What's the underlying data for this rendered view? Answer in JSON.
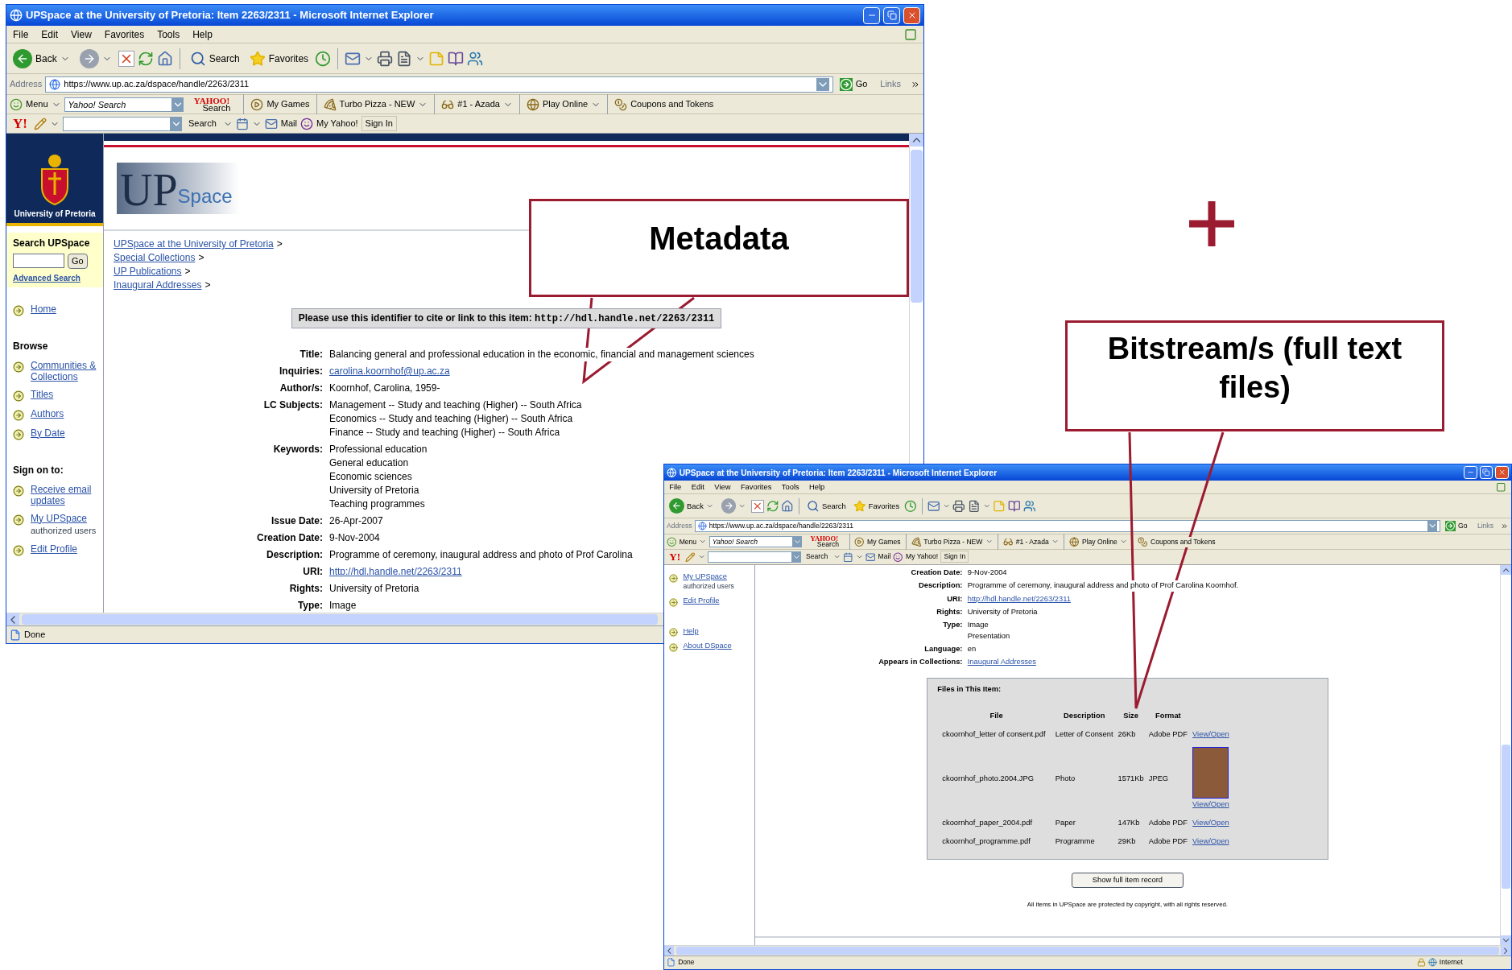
{
  "slide": {
    "callouts": [
      {
        "text": "Metadata"
      },
      {
        "text": "Bitstream/s (full text files)"
      }
    ],
    "windows": [
      {
        "title": "UPSpace at the University of Pretoria: Item 2263/2311 - Microsoft Internet Explorer",
        "menu": [
          "File",
          "Edit",
          "View",
          "Favorites",
          "Tools",
          "Help"
        ],
        "toolbar": {
          "back": "Back",
          "search": "Search",
          "favorites": "Favorites"
        },
        "address": {
          "label": "Address",
          "url": "https://www.up.ac.za/dspace/handle/2263/2311",
          "go": "Go",
          "links": "Links"
        },
        "yahoo_bar": {
          "menu": "Menu",
          "search_placeholder": "Yahoo! Search",
          "logo_top": "YAHOO!",
          "logo_bottom": "Search",
          "items": [
            {
              "text": "My Games",
              "has_menu": false
            },
            {
              "text": "Turbo Pizza - NEW",
              "has_menu": true
            },
            {
              "text": "#1 - Azada",
              "has_menu": true
            },
            {
              "text": "Play Online",
              "has_menu": true
            },
            {
              "text": "Coupons and Tokens",
              "has_menu": false
            }
          ]
        },
        "yahoo_bar2": {
          "logo": "Y!",
          "search": "Search",
          "mail": "Mail",
          "my_yahoo": "My Yahoo!",
          "sign_in": "Sign In"
        },
        "status": {
          "text": "Done"
        },
        "sidebar": {
          "logo_caption": "University of Pretoria",
          "search": {
            "title": "Search UPSpace",
            "go": "Go",
            "advanced": "Advanced Search"
          },
          "items": [
            {
              "kind": "link",
              "text": "Home"
            },
            {
              "kind": "heading",
              "text": "Browse"
            },
            {
              "kind": "link",
              "text": "Communities & Collections"
            },
            {
              "kind": "link",
              "text": "Titles"
            },
            {
              "kind": "link",
              "text": "Authors"
            },
            {
              "kind": "link",
              "text": "By Date"
            },
            {
              "kind": "heading",
              "text": "Sign on to:"
            },
            {
              "kind": "link",
              "text": "Receive email updates"
            },
            {
              "kind": "link",
              "text": "My UPSpace",
              "note": "authorized users"
            },
            {
              "kind": "link",
              "text": "Edit Profile"
            }
          ]
        },
        "header": {
          "logo_left": "UP",
          "logo_right": "Space"
        },
        "breadcrumbs": [
          "UPSpace at the University of Pretoria",
          "Special Collections",
          "UP Publications",
          "Inaugural Addresses"
        ],
        "breadcrumb_separator": ">",
        "identifier": {
          "label": "Please use this identifier to cite or link to this item:",
          "url": "http://hdl.handle.net/2263/2311"
        },
        "metadata": [
          {
            "label": "Title:",
            "values": [
              {
                "text": "Balancing general and professional education in the economic, financial and management sciences",
                "link": false
              }
            ]
          },
          {
            "label": "Inquiries:",
            "values": [
              {
                "text": "carolina.koornhof@up.ac.za",
                "link": true
              }
            ]
          },
          {
            "label": "Author/s:",
            "values": [
              {
                "text": "Koornhof, Carolina, 1959-",
                "link": false
              }
            ]
          },
          {
            "label": "LC Subjects:",
            "values": [
              {
                "text": "Management -- Study and teaching (Higher) -- South Africa",
                "link": false
              },
              {
                "text": "Economics -- Study and teaching (Higher) -- South Africa",
                "link": false
              },
              {
                "text": "Finance -- Study and teaching (Higher) -- South Africa",
                "link": false
              }
            ]
          },
          {
            "label": "Keywords:",
            "values": [
              {
                "text": "Professional education",
                "link": false
              },
              {
                "text": "General education",
                "link": false
              },
              {
                "text": "Economic sciences",
                "link": false
              },
              {
                "text": "University of Pretoria",
                "link": false
              },
              {
                "text": "Teaching programmes",
                "link": false
              }
            ]
          },
          {
            "label": "Issue Date:",
            "values": [
              {
                "text": "26-Apr-2007",
                "link": false
              }
            ]
          },
          {
            "label": "Creation Date:",
            "values": [
              {
                "text": "9-Nov-2004",
                "link": false
              }
            ]
          },
          {
            "label": "Description:",
            "values": [
              {
                "text": "Programme of ceremony, inaugural address and photo of Prof Carolina",
                "link": false
              }
            ]
          },
          {
            "label": "URI:",
            "values": [
              {
                "text": "http://hdl.handle.net/2263/2311",
                "link": true
              }
            ]
          },
          {
            "label": "Rights:",
            "values": [
              {
                "text": "University of Pretoria",
                "link": false
              }
            ]
          },
          {
            "label": "Type:",
            "values": [
              {
                "text": "Image",
                "link": false
              }
            ]
          }
        ]
      },
      {
        "title": "UPSpace at the University of Pretoria: Item 2263/2311 - Microsoft Internet Explorer",
        "menu": [
          "File",
          "Edit",
          "View",
          "Favorites",
          "Tools",
          "Help"
        ],
        "toolbar": {
          "back": "Back",
          "search": "Search",
          "favorites": "Favorites"
        },
        "address": {
          "label": "Address",
          "url": "https://www.up.ac.za/dspace/handle/2263/2311",
          "go": "Go",
          "links": "Links"
        },
        "yahoo_bar": {
          "menu": "Menu",
          "search_placeholder": "Yahoo! Search",
          "logo_top": "YAHOO!",
          "logo_bottom": "Search",
          "items": [
            {
              "text": "My Games",
              "has_menu": false
            },
            {
              "text": "Turbo Pizza - NEW",
              "has_menu": true
            },
            {
              "text": "#1 - Azada",
              "has_menu": true
            },
            {
              "text": "Play Online",
              "has_menu": true
            },
            {
              "text": "Coupons and Tokens",
              "has_menu": false
            }
          ]
        },
        "yahoo_bar2": {
          "logo": "Y!",
          "search": "Search",
          "mail": "Mail",
          "my_yahoo": "My Yahoo!",
          "sign_in": "Sign In"
        },
        "status": {
          "text": "Done",
          "zone": "Internet"
        },
        "sidebar": {
          "items": [
            {
              "kind": "link",
              "text": "My UPSpace",
              "note": "authorized users"
            },
            {
              "kind": "link",
              "text": "Edit Profile"
            },
            {
              "kind": "link",
              "text": "Help",
              "gap": true
            },
            {
              "kind": "link",
              "text": "About DSpace"
            }
          ]
        },
        "metadata": [
          {
            "label": "Creation Date:",
            "values": [
              {
                "text": "9-Nov-2004",
                "link": false
              }
            ]
          },
          {
            "label": "Description:",
            "values": [
              {
                "text": "Programme of ceremony, inaugural address and photo of Prof Carolina Koornhof.",
                "link": false
              }
            ]
          },
          {
            "label": "URI:",
            "values": [
              {
                "text": "http://hdl.handle.net/2263/2311",
                "link": true
              }
            ]
          },
          {
            "label": "Rights:",
            "values": [
              {
                "text": "University of Pretoria",
                "link": false
              }
            ]
          },
          {
            "label": "Type:",
            "values": [
              {
                "text": "Image",
                "link": false
              },
              {
                "text": "Presentation",
                "link": false
              }
            ]
          },
          {
            "label": "Language:",
            "values": [
              {
                "text": "en",
                "link": false
              }
            ]
          },
          {
            "label": "Appears in Collections:",
            "values": [
              {
                "text": "Inaugural Addresses",
                "link": true
              }
            ]
          }
        ],
        "files": {
          "title": "Files in This Item:",
          "columns": [
            "File",
            "Description",
            "Size",
            "Format"
          ],
          "rows": [
            {
              "file": "ckoornhof_letter of consent.pdf",
              "description": "Letter of Consent",
              "size": "26Kb",
              "format": "Adobe PDF",
              "link": "View/Open",
              "thumbnail": false
            },
            {
              "file": "ckoornhof_photo.2004.JPG",
              "description": "Photo",
              "size": "1571Kb",
              "format": "JPEG",
              "link": "View/Open",
              "thumbnail": true
            },
            {
              "file": "ckoornhof_paper_2004.pdf",
              "description": "Paper",
              "size": "147Kb",
              "format": "Adobe PDF",
              "link": "View/Open",
              "thumbnail": false
            },
            {
              "file": "ckoornhof_programme.pdf",
              "description": "Programme",
              "size": "29Kb",
              "format": "Adobe PDF",
              "link": "View/Open",
              "thumbnail": false
            }
          ]
        },
        "button": "Show full item record",
        "footer": "All items in UPSpace are protected by copyright, with all rights reserved."
      }
    ]
  }
}
